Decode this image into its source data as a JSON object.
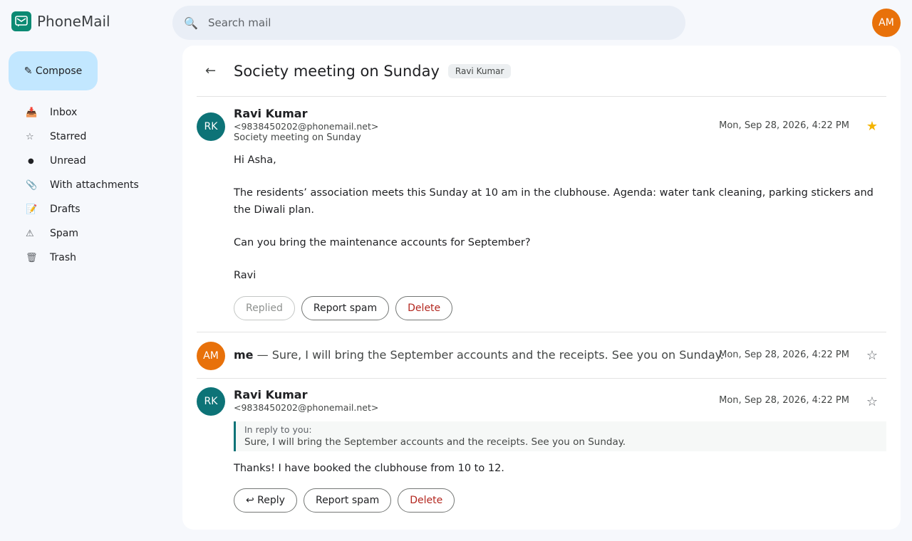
{
  "app": {
    "name": "PhoneMail",
    "logo_icon": "mail-icon",
    "brand_color": "#0b8a73"
  },
  "search": {
    "placeholder": "Search mail",
    "value": ""
  },
  "account": {
    "initials": "AM"
  },
  "compose": {
    "label": "✎ Compose"
  },
  "sidebar": {
    "items": [
      {
        "label": "Inbox",
        "icon": "📥"
      },
      {
        "label": "Starred",
        "icon": "☆"
      },
      {
        "label": "Unread",
        "icon": "●"
      },
      {
        "label": "With attachments",
        "icon": "📎"
      },
      {
        "label": "Drafts",
        "icon": "📝"
      },
      {
        "label": "Spam",
        "icon": "⚠"
      },
      {
        "label": "Trash",
        "icon": "🗑"
      }
    ]
  },
  "thread": {
    "back_icon": "←",
    "subject": "Society meeting on Sunday",
    "label": "Ravi Kumar",
    "messages": [
      {
        "initials": "RK",
        "sender": "Ravi Kumar",
        "email": "<9838450202@phonemail.net>",
        "subject": "Society meeting on Sunday",
        "date": "Mon, Sep 28, 2026, 4:22 PM",
        "starred": true,
        "star_icon": "★",
        "body": [
          "Hi Asha,",
          "The residents’ association meets this Sunday at 10 am in the clubhouse. Agenda: water tank cleaning, parking stickers and the Diwali plan.",
          "Can you bring the maintenance accounts for September?",
          "Ravi"
        ],
        "actions": {
          "replied": "Replied",
          "spam": "Report spam",
          "delete": "Delete"
        }
      },
      {
        "initials": "AM",
        "sender": "me",
        "separator": "—",
        "snippet": "Sure, I will bring the September accounts and the receipts. See you on Sunday.",
        "date": "Mon, Sep 28, 2026, 4:22 PM",
        "starred": false,
        "star_icon": "☆"
      },
      {
        "initials": "RK",
        "sender": "Ravi Kumar",
        "email": "<9838450202@phonemail.net>",
        "date": "Mon, Sep 28, 2026, 4:22 PM",
        "starred": false,
        "star_icon": "☆",
        "quote_label": "In reply to you:",
        "quote_text": "Sure, I will bring the September accounts and the receipts. See you on Sunday.",
        "body": [
          "Thanks! I have booked the clubhouse from 10 to 12."
        ],
        "actions": {
          "reply": "↩ Reply",
          "spam": "Report spam",
          "delete": "Delete"
        }
      }
    ]
  }
}
